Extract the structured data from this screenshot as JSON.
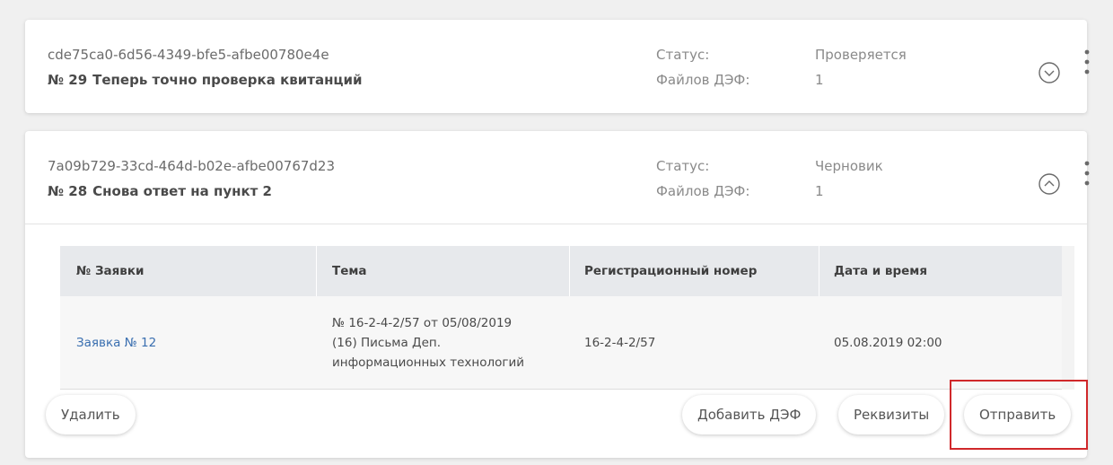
{
  "status_label": "Статус:",
  "files_label": "Файлов ДЭФ:",
  "cards": [
    {
      "guid": "cde75ca0-6d56-4349-bfe5-afbe00780e4e",
      "number": "№ 29",
      "title": "Теперь точно проверка квитанций",
      "status": "Проверяется",
      "files_count": "1",
      "expanded": false
    },
    {
      "guid": "7a09b729-33cd-464d-b02e-afbe00767d23",
      "number": "№ 28",
      "title": "Снова ответ на пункт 2",
      "status": "Черновик",
      "files_count": "1",
      "expanded": true
    }
  ],
  "table": {
    "headers": [
      "№ Заявки",
      "Тема",
      "Регистрационный номер",
      "Дата и время"
    ],
    "rows": [
      {
        "request": "Заявка № 12",
        "topic_lines": [
          "№ 16-2-4-2/57 от 05/08/2019",
          "(16) Письма Деп.",
          "информационных технологий"
        ],
        "reg_number": "16-2-4-2/57",
        "datetime": "05.08.2019 02:00"
      }
    ]
  },
  "buttons": {
    "delete": "Удалить",
    "add_def": "Добавить ДЭФ",
    "requisites": "Реквизиты",
    "send": "Отправить"
  },
  "icons": {
    "collapsed_toggle": "chevron-down-circle-icon",
    "expanded_toggle": "chevron-up-circle-icon",
    "menu": "kebab-menu-icon"
  },
  "colors": {
    "link": "#3a6fb0",
    "highlight": "#d0282b"
  }
}
